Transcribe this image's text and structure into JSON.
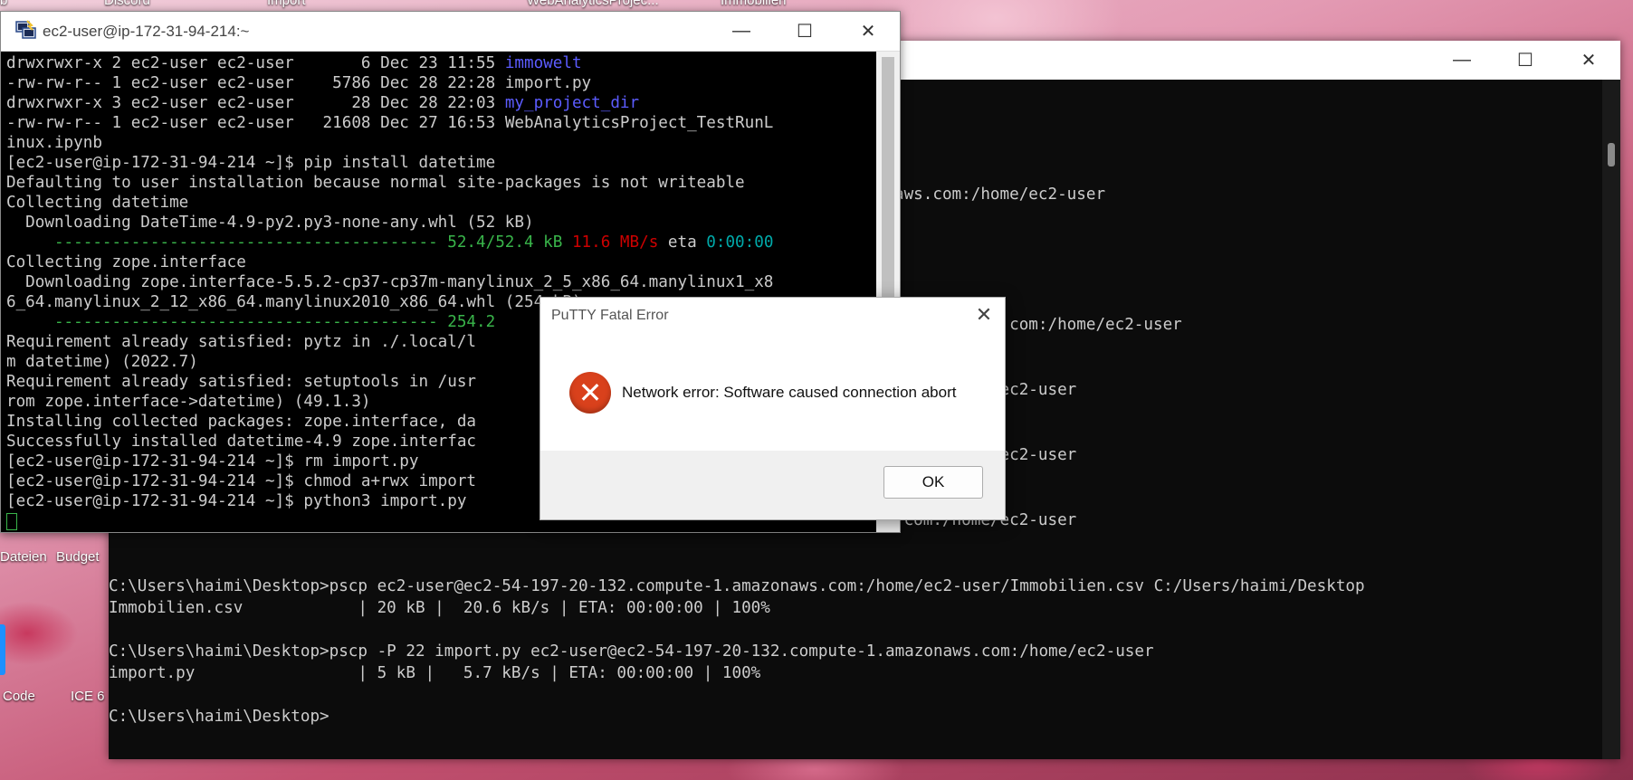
{
  "desktop": {
    "icons_top": [
      "b",
      "Discord",
      "Import",
      "WebAnalyticsProjec...",
      "Immobilien"
    ],
    "icons_left": [
      "Dateien",
      "Budget",
      "Code",
      "ICE 6"
    ]
  },
  "cmd_window": {
    "controls": {
      "minimize": "—",
      "maximize": "☐",
      "close": "✕"
    },
    "partial_lines": [
      "aws.com:/home/ec2-user",
      "1.amazonaws.com:/home/ec2-user",
      ".com:/home/ec2-user",
      ".com:/home/ec2-user",
      ".com:/home/ec2-user"
    ],
    "lines": [
      "C:\\Users\\haimi\\Desktop>pscp ec2-user@ec2-54-197-20-132.compute-1.amazonaws.com:/home/ec2-user/Immobilien.csv C:/Users/haimi/Desktop",
      "Immobilien.csv            | 20 kB |  20.6 kB/s | ETA: 00:00:00 | 100%",
      "",
      "C:\\Users\\haimi\\Desktop>pscp -P 22 import.py ec2-user@ec2-54-197-20-132.compute-1.amazonaws.com:/home/ec2-user",
      "import.py                 | 5 kB |   5.7 kB/s | ETA: 00:00:00 | 100%",
      "",
      "C:\\Users\\haimi\\Desktop>"
    ]
  },
  "putty": {
    "title": "ec2-user@ip-172-31-94-214:~",
    "controls": {
      "minimize": "—",
      "maximize": "☐",
      "close": "✕"
    },
    "ls": [
      {
        "perm": "drwxrwxr-x 2 ec2-user ec2-user       6 Dec 23 11:55 ",
        "name": "immowelt",
        "dir": true
      },
      {
        "perm": "-rw-rw-r-- 1 ec2-user ec2-user    5786 Dec 28 22:28 ",
        "name": "import.py",
        "dir": false
      },
      {
        "perm": "drwxrwxr-x 3 ec2-user ec2-user      28 Dec 28 22:03 ",
        "name": "my_project_dir",
        "dir": true
      },
      {
        "perm": "-rw-rw-r-- 1 ec2-user ec2-user   21608 Dec 27 16:53 ",
        "name": "WebAnalyticsProject_TestRunL",
        "dir": false
      }
    ],
    "wrap_line": "inux.ipynb",
    "lines_a": [
      "[ec2-user@ip-172-31-94-214 ~]$ pip install datetime",
      "Defaulting to user installation because normal site-packages is not writeable",
      "Collecting datetime",
      "  Downloading DateTime-4.9-py2.py3-none-any.whl (52 kB)"
    ],
    "progress1": {
      "bar": "     ---------------------------------------- ",
      "size": "52.4/52.4 kB",
      "speed": "11.6 MB/s",
      "eta_label": " eta ",
      "eta": "0:00:00"
    },
    "lines_b": [
      "Collecting zope.interface",
      "  Downloading zope.interface-5.5.2-cp37-cp37m-manylinux_2_5_x86_64.manylinux1_x8",
      "6_64.manylinux_2_12_x86_64.manylinux2010_x86_64.whl (254 kB)"
    ],
    "progress2": {
      "bar": "     ---------------------------------------- ",
      "size": "254.2"
    },
    "lines_c": [
      "Requirement already satisfied: pytz in ./.local/l",
      "m datetime) (2022.7)",
      "Requirement already satisfied: setuptools in /usr",
      "rom zope.interface->datetime) (49.1.3)",
      "Installing collected packages: zope.interface, da",
      "Successfully installed datetime-4.9 zope.interfac",
      "[ec2-user@ip-172-31-94-214 ~]$ rm import.py",
      "[ec2-user@ip-172-31-94-214 ~]$ chmod a+rwx import",
      "[ec2-user@ip-172-31-94-214 ~]$ python3 import.py"
    ]
  },
  "dialog": {
    "title": "PuTTY Fatal Error",
    "message": "Network error: Software caused connection abort",
    "ok_label": "OK",
    "close_glyph": "✕",
    "error_glyph": "✕",
    "error_color": "#d9411c"
  }
}
